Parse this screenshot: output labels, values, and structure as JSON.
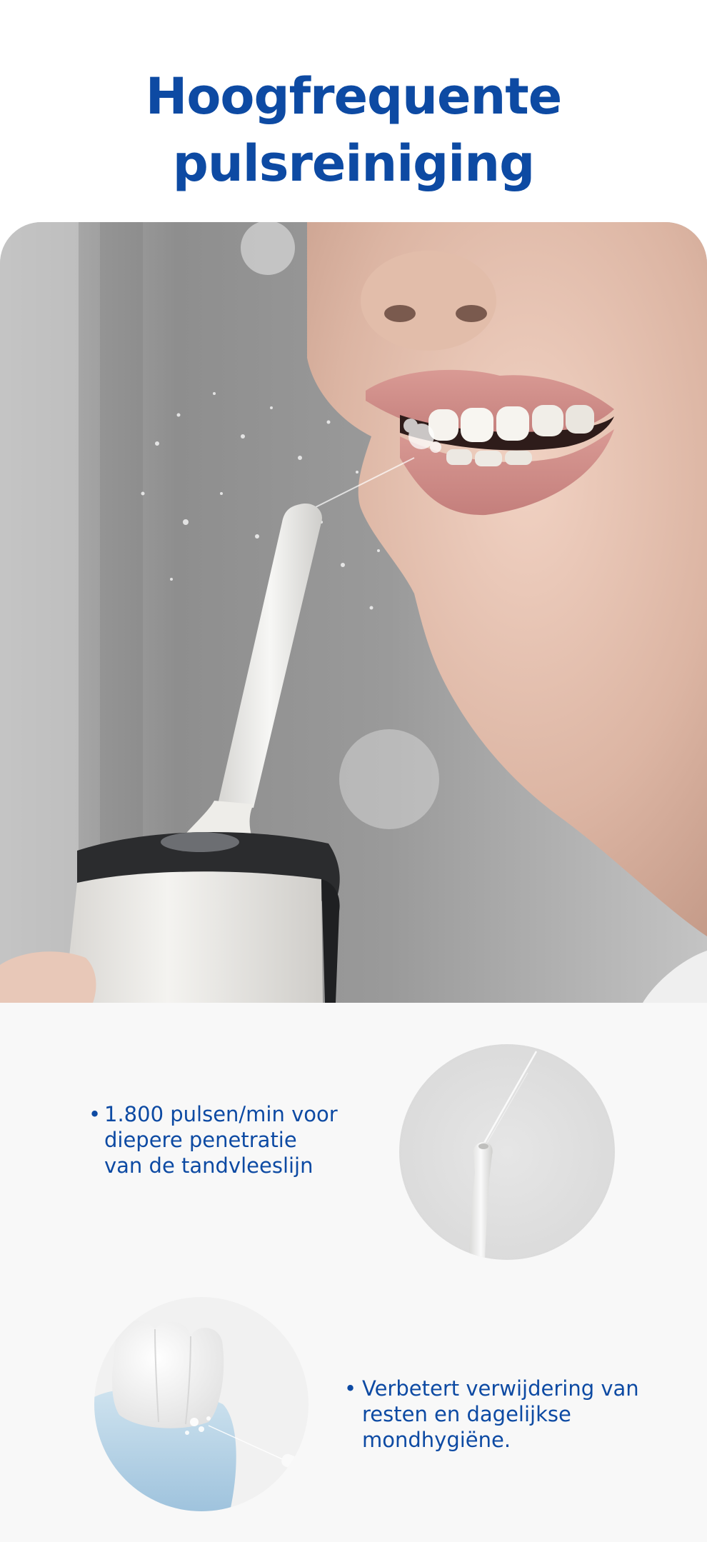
{
  "headline": {
    "line1": "Hoogfrequente",
    "line2": "pulsreiniging"
  },
  "hero": {
    "icon": "photo-woman-using-water-flosser"
  },
  "features": [
    {
      "bullet": "•",
      "text": "1.800 pulsen/min voor\ndiepere penetratie\nvan de tandvleeslijn",
      "icon": "flosser-tip-spray-photo"
    },
    {
      "bullet": "•",
      "text": "Verbetert verwijdering van\nresten en dagelijkse\nmondhygiëne.",
      "icon": "teeth-gum-cleaning-illustration"
    }
  ],
  "colors": {
    "brand_blue": "#0d4aa3",
    "panel_bg": "#f8f8f8"
  }
}
